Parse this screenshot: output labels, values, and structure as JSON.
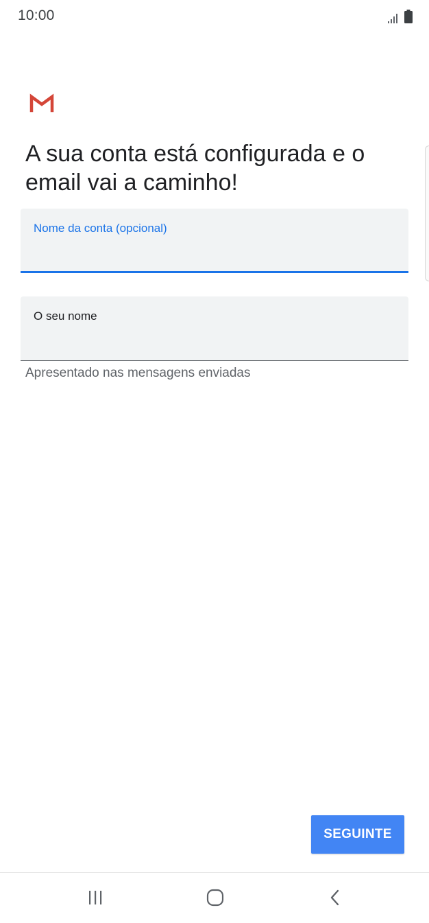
{
  "status_bar": {
    "time": "10:00",
    "signal_icon": "signal-icon",
    "battery_icon": "battery-icon"
  },
  "logo": {
    "icon": "gmail-logo",
    "color": "#d44638"
  },
  "headline": "A sua conta está configurada e o email vai a caminho!",
  "form": {
    "account_name": {
      "label": "Nome da conta (opcional)",
      "value": "",
      "accent_color": "#1a73e8"
    },
    "your_name": {
      "label": "O seu nome",
      "value": "",
      "helper": "Apresentado nas mensagens enviadas"
    }
  },
  "next_button": {
    "label": "SEGUINTE",
    "color": "#4285f4"
  },
  "nav_bar": {
    "recents_icon": "recents-icon",
    "home_icon": "home-icon",
    "back_icon": "back-icon"
  }
}
